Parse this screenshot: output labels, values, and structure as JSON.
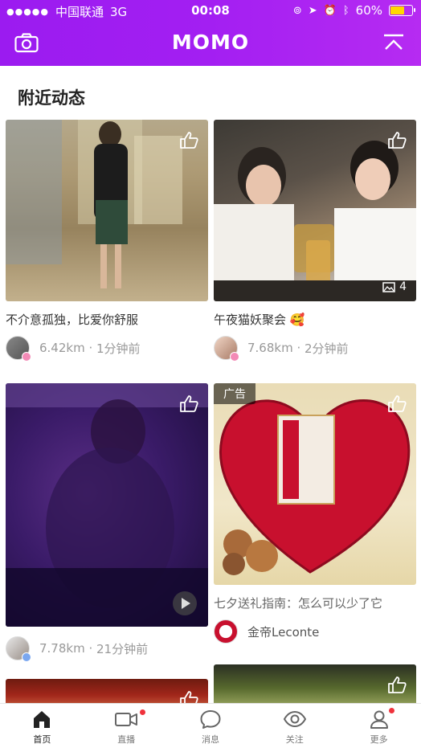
{
  "status_bar": {
    "carrier": "中国联通",
    "network": "3G",
    "time": "00:08",
    "battery_text": "60%",
    "battery_level": 0.6,
    "battery_color": "#ffd700"
  },
  "header": {
    "title": "MOMO",
    "brand_color": "#a31ff2",
    "left_icon": "camera-icon",
    "right_icon": "scroll-to-top-icon"
  },
  "section": {
    "title": "附近动态"
  },
  "feed": [
    {
      "caption": "不介意孤独，比爱你舒服",
      "distance": "6.42km",
      "time": "1分钟前",
      "photo": "room"
    },
    {
      "caption": "午夜猫妖聚会",
      "caption_emoji": "🥰",
      "distance": "7.68km",
      "time": "2分钟前",
      "photo_count": "4",
      "photo": "party"
    },
    {
      "distance": "7.78km",
      "time": "21分钟前",
      "is_video": true,
      "photo": "dark"
    },
    {
      "ad_label": "广告",
      "caption": "七夕送礼指南：怎么可以少了它",
      "advertiser": "金帝Leconte",
      "photo": "candy"
    }
  ],
  "tabbar": {
    "items": [
      {
        "label": "首页",
        "icon": "home-icon",
        "active": true,
        "badge": false
      },
      {
        "label": "直播",
        "icon": "video-camera-icon",
        "active": false,
        "badge": true
      },
      {
        "label": "消息",
        "icon": "chat-bubble-icon",
        "active": false,
        "badge": false
      },
      {
        "label": "关注",
        "icon": "eye-icon",
        "active": false,
        "badge": false
      },
      {
        "label": "更多",
        "icon": "person-icon",
        "active": false,
        "badge": true
      }
    ],
    "badge_color": "#f0323c"
  }
}
